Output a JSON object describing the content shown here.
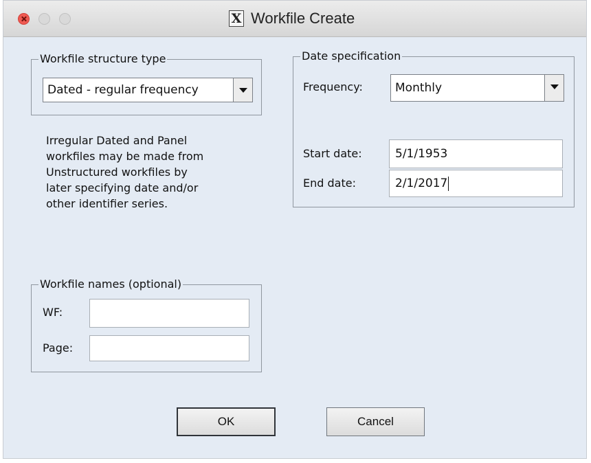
{
  "window": {
    "title": "Workfile Create",
    "app_icon_glyph": "X"
  },
  "structure": {
    "legend": "Workfile structure type",
    "selected": "Dated - regular frequency"
  },
  "note": {
    "lines": [
      "Irregular Dated and Panel",
      "workfiles may be made from",
      "Unstructured workfiles by",
      "later specifying date and/or",
      "other identifier series."
    ]
  },
  "date_spec": {
    "legend": "Date specification",
    "frequency_label": "Frequency:",
    "frequency_value": "Monthly",
    "start_label": "Start date:",
    "start_value": "5/1/1953",
    "end_label": "End date:",
    "end_value": "2/1/2017"
  },
  "names": {
    "legend": "Workfile names (optional)",
    "wf_label": "WF:",
    "wf_value": "",
    "page_label": "Page:",
    "page_value": ""
  },
  "buttons": {
    "ok": "OK",
    "cancel": "Cancel"
  },
  "colors": {
    "dialog_background": "#e4ebf4",
    "close_button": "#ef5a52"
  }
}
